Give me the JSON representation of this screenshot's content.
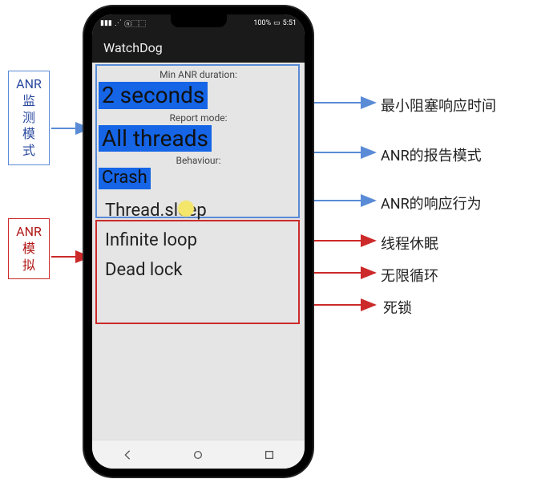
{
  "status_bar": {
    "signal": "▮▮▮",
    "wifi": "⋰",
    "icons": "ⓝ⬚⬚",
    "battery": "100%",
    "battery_icon": "▭",
    "time": "5:51"
  },
  "app": {
    "title": "WatchDog"
  },
  "monitor": {
    "duration_label": "Min ANR duration:",
    "duration_value": "2 seconds",
    "report_label": "Report mode:",
    "report_value": "All threads",
    "behaviour_label": "Behaviour:",
    "behaviour_value": "Crash"
  },
  "simulate": {
    "item1": "Thread.sleep",
    "item2": "Infinite loop",
    "item3": "Dead lock"
  },
  "annotations": {
    "left_top": "ANR\n监\n测\n模\n式",
    "left_bottom": "ANR\n模\n拟",
    "right1": "最小阻塞响应时间",
    "right2": "ANR的报告模式",
    "right3": "ANR的响应行为",
    "right4": "线程休眠",
    "right5": "无限循环",
    "right6": "死锁"
  },
  "colors": {
    "blue": "#5a8bd6",
    "red": "#cc2a2a",
    "highlight": "#1565e6"
  }
}
